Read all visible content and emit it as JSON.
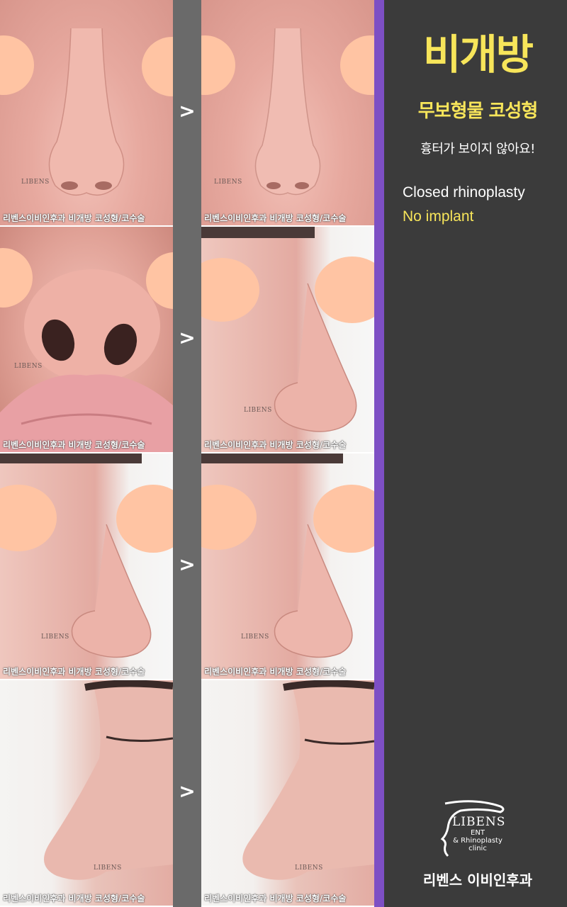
{
  "arrows": [
    ">",
    ">",
    ">",
    ">"
  ],
  "watermark": {
    "logo_text": "LIBENS",
    "caption": "리벤스이비인후과  비개방 코성형/코수술"
  },
  "panel": {
    "title": "비개방",
    "subtitle": "무보형물 코성형",
    "tagline": "흉터가 보이지 않아요!",
    "english_line_1": "Closed rhinoplasty",
    "english_line_2": "No implant"
  },
  "logo": {
    "brand": "LIBENS",
    "line1": "ENT",
    "line2": "& Rhinoplasty",
    "line3": "clinic"
  },
  "clinic_name": "리벤스 이비인후과",
  "colors": {
    "accent_yellow": "#f7e55a",
    "purple_bar": "#7d4fc4",
    "panel_bg": "#3b3b3b",
    "divider": "#6a6a6a",
    "blur_patch": "#ffc4a3"
  }
}
